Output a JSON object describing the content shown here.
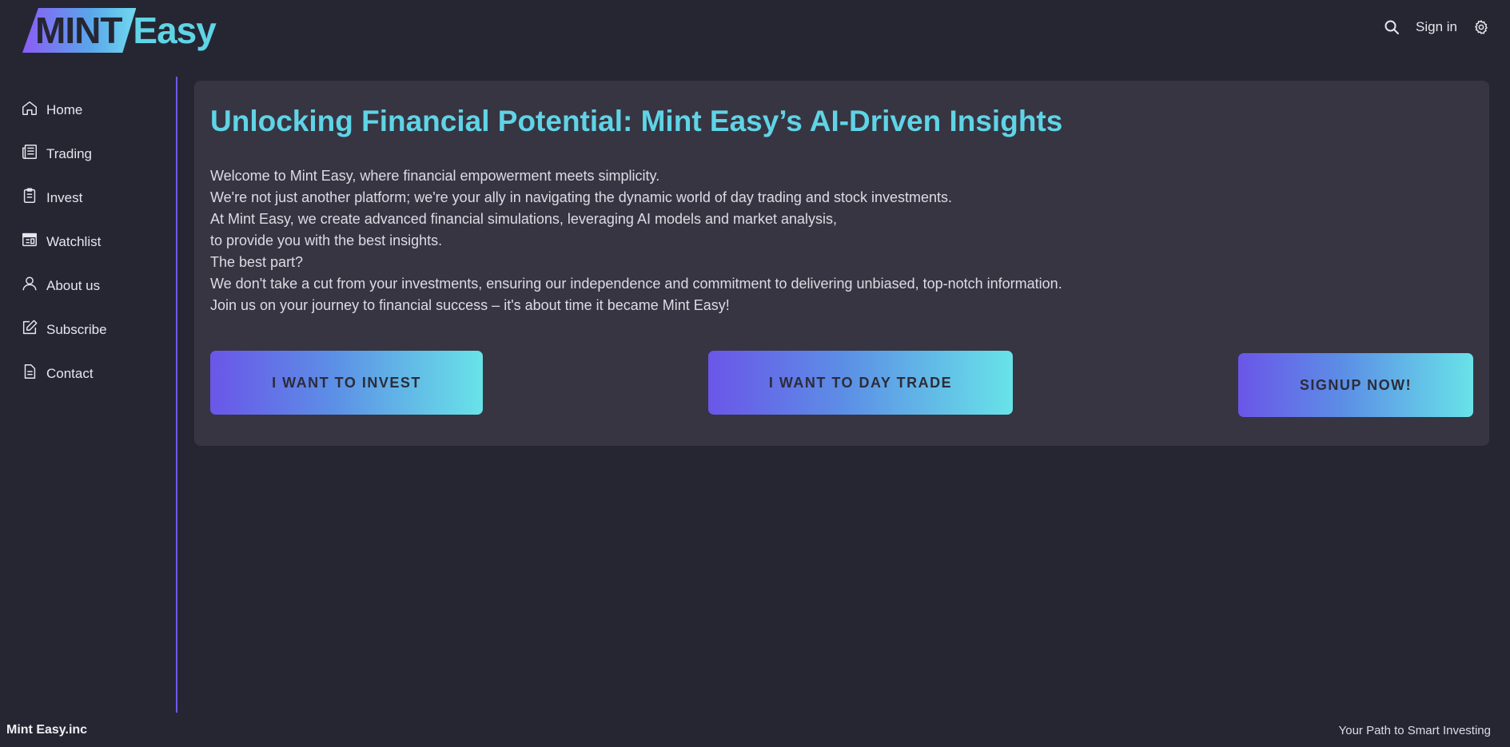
{
  "logo": {
    "part1": "MINT",
    "part2": "Easy"
  },
  "header": {
    "search_icon": "search-icon",
    "signin_label": "Sign in",
    "settings_icon": "gear-icon"
  },
  "sidebar": {
    "items": [
      {
        "label": "Home",
        "icon": "home-icon"
      },
      {
        "label": "Trading",
        "icon": "newspaper-icon"
      },
      {
        "label": "Invest",
        "icon": "clipboard-icon"
      },
      {
        "label": "Watchlist",
        "icon": "window-icon"
      },
      {
        "label": "About us",
        "icon": "user-icon"
      },
      {
        "label": "Subscribe",
        "icon": "edit-icon"
      },
      {
        "label": "Contact",
        "icon": "document-icon"
      }
    ]
  },
  "main": {
    "title": "Unlocking Financial Potential: Mint Easy’s AI-Driven Insights",
    "paragraphs": [
      "Welcome to Mint Easy, where financial empowerment meets simplicity.",
      "We're not just another platform; we're your ally in navigating the dynamic world of day trading and stock investments.",
      "At Mint Easy, we create advanced financial simulations, leveraging AI models and market analysis,",
      "to provide you with the best insights.",
      "The best part?",
      "We don't take a cut from your investments, ensuring our independence and commitment to delivering unbiased, top-notch information.",
      "Join us on your journey to financial success – it's about time it became Mint Easy!"
    ],
    "buttons": {
      "invest": "I WANT TO INVEST",
      "day_trade": "I WANT TO DAY TRADE",
      "signup": "SIGNUP NOW!"
    }
  },
  "footer": {
    "company": "Mint Easy.inc",
    "tagline": "Your Path to Smart Investing"
  },
  "colors": {
    "background": "#262633",
    "card": "#373542",
    "accent": "#5fd4e6",
    "accent_purple": "#6e5ae6"
  }
}
